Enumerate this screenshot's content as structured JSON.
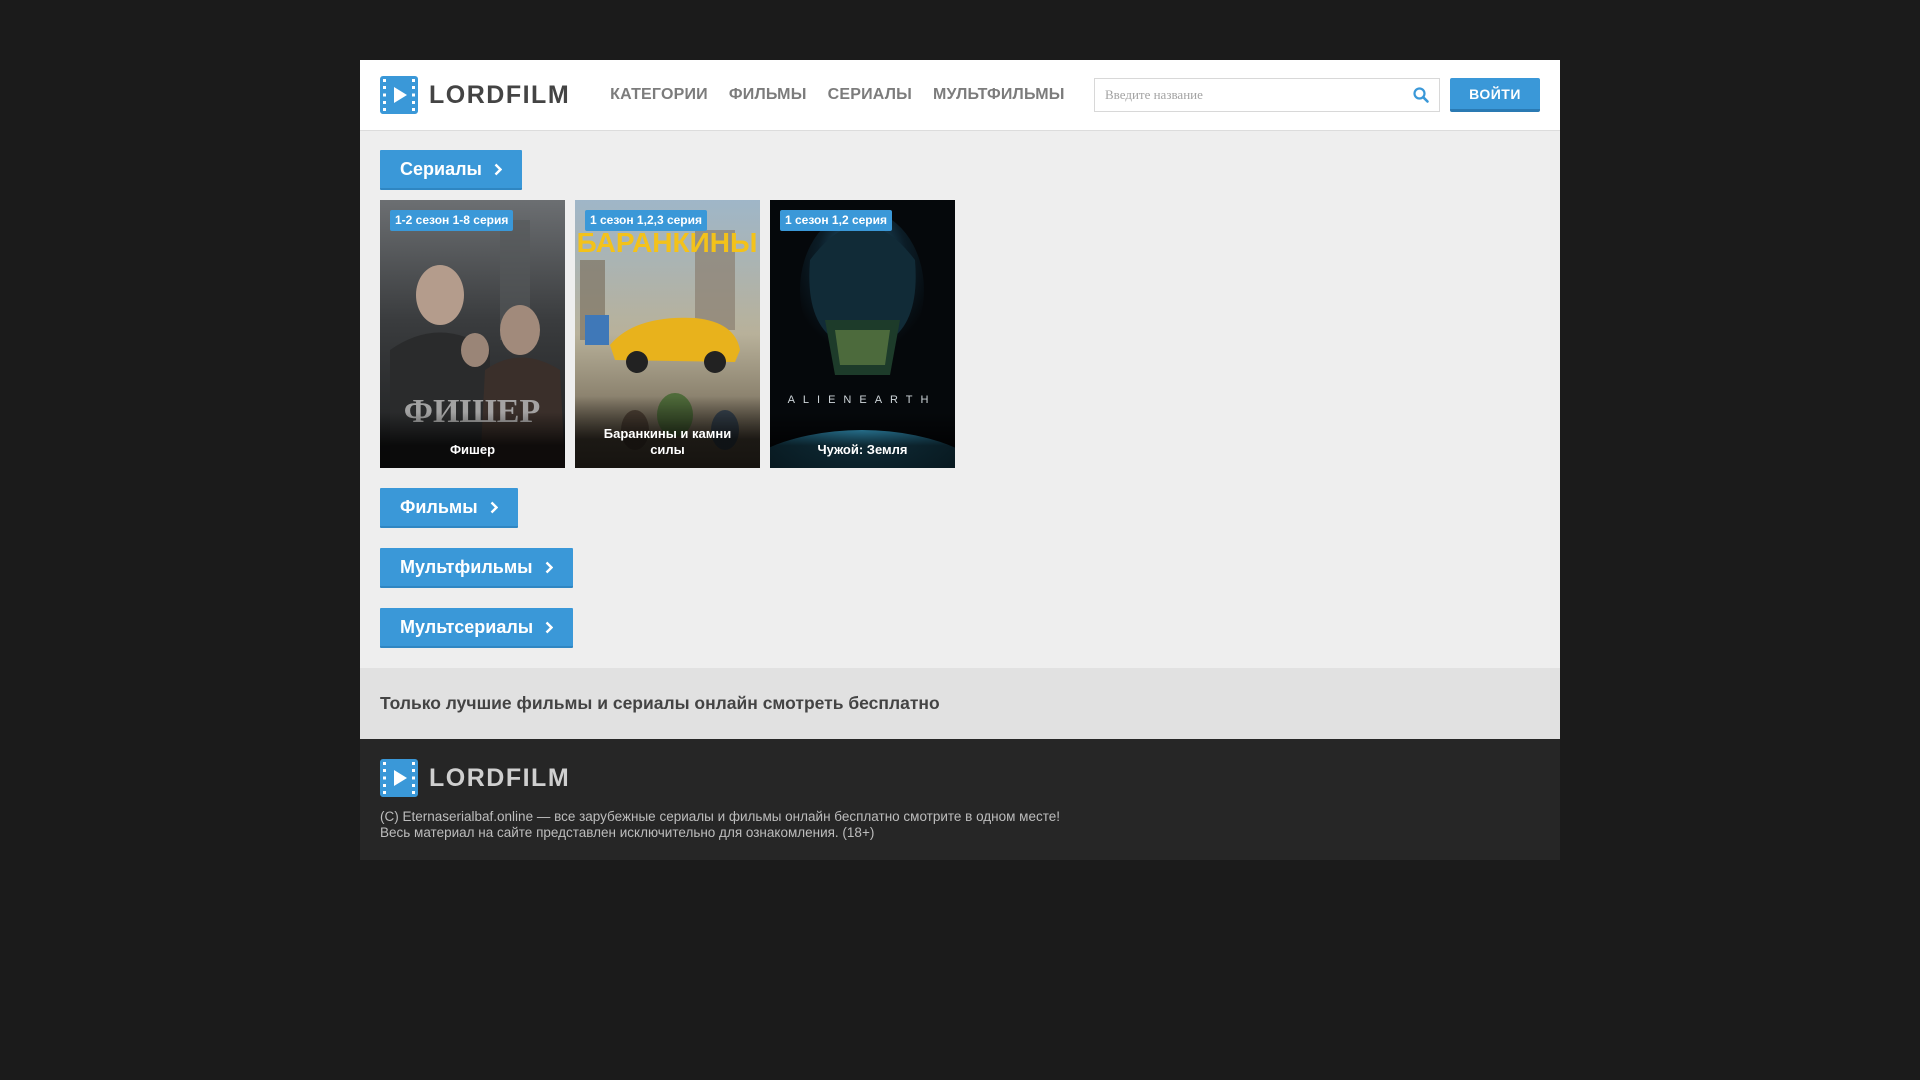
{
  "header": {
    "logo_text": "LORDFILM",
    "nav": [
      "КАТЕГОРИИ",
      "ФИЛЬМЫ",
      "СЕРИАЛЫ",
      "МУЛЬТФИЛЬМЫ"
    ],
    "search_placeholder": "Введите название",
    "login_label": "ВОЙТИ"
  },
  "sections": [
    {
      "label": "Сериалы",
      "items": [
        {
          "badge": "1-2 сезон 1-8 серия",
          "title": "Фишер"
        },
        {
          "badge": "1 сезон 1,2,3 серия",
          "title": "Баранкины и камни силы"
        },
        {
          "badge": "1 сезон 1,2 серия",
          "title": "Чужой: Земля"
        }
      ]
    },
    {
      "label": "Фильмы"
    },
    {
      "label": "Мультфильмы"
    },
    {
      "label": "Мультсериалы"
    }
  ],
  "tagline": "Только лучшие фильмы и сериалы онлайн смотреть бесплатно",
  "footer": {
    "logo_text": "LORDFILM",
    "line1": "(C) Eternaserialbaf.online — все зарубежные сериалы и фильмы онлайн бесплатно смотрите в одном месте!",
    "line2": "Весь материал на сайте представлен исключительно для ознакомления. (18+)"
  },
  "colors": {
    "accent": "#3a98d8",
    "page_bg": "#1b1b1b",
    "content_bg": "#eeeeee"
  }
}
